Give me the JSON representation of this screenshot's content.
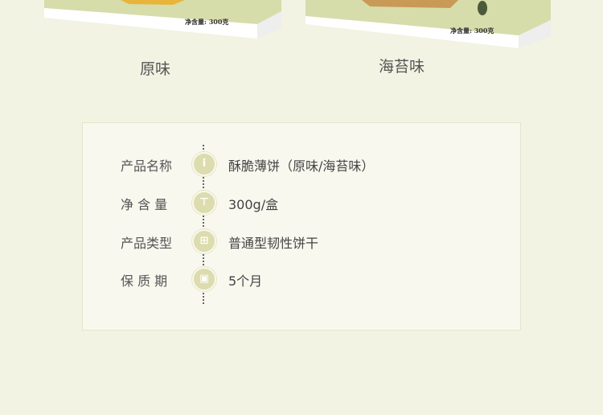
{
  "products": [
    {
      "name": "原味",
      "box_label": "净含量: 300克"
    },
    {
      "name": "海苔味",
      "box_label": "净含量: 300克"
    }
  ],
  "specs": [
    {
      "label": "产品名称",
      "icon": "info-icon",
      "value": "酥脆薄饼（原味/海苔味）"
    },
    {
      "label": "净 含 量",
      "icon": "scale-icon",
      "value": "300g/盒"
    },
    {
      "label": "产品类型",
      "icon": "grid-icon",
      "value": "普通型韧性饼干"
    },
    {
      "label": "保 质 期",
      "icon": "calendar-icon",
      "value": "5个月"
    }
  ],
  "colors": {
    "background": "#f2f3e3",
    "icon": "#dcdcae",
    "box_green": "#d6dba8"
  }
}
